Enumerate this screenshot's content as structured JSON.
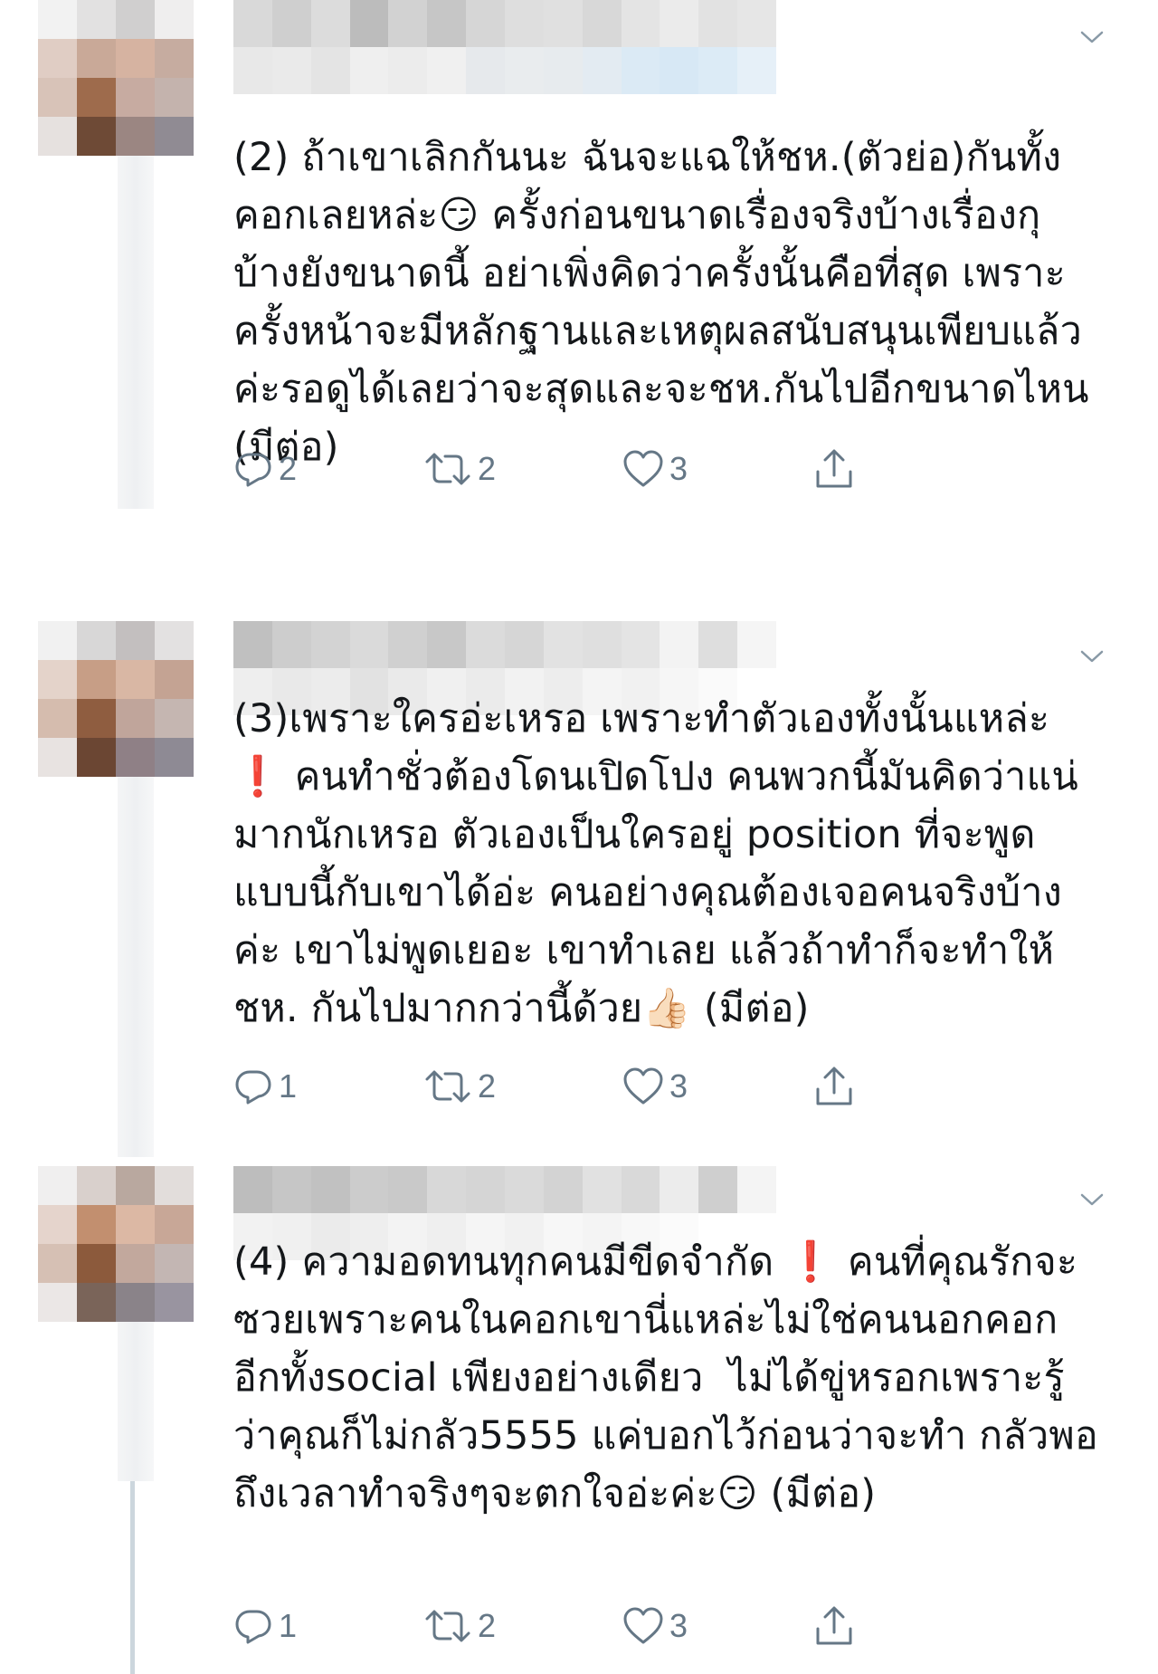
{
  "tweets": [
    {
      "text": "(2) ถ้าเขาเลิกกันนะ ฉันจะแฉให้ชห.(ตัวย่อ)กันทั้งคอกเลยหล่ะ😏 ครั้งก่อนขนาดเรื่องจริงบ้างเรื่องกุบ้างยังขนาดนี้ อย่าเพิ่งคิดว่าครั้งนั้นคือที่สุด เพราะครั้งหน้าจะมีหลักฐานและเหตุผลสนับสนุนเพียบแล้วค่ะรอดูได้เลยว่าจะสุดและจะชห.กันไปอีกขนาดไหน (มีต่อ)",
      "replies": "2",
      "retweets": "2",
      "likes": "3"
    },
    {
      "text": "(3)เพราะใครอ่ะเหรอ เพราะทำตัวเองทั้งนั้นแหล่ะ ❗️ คนทำชั่วต้องโดนเปิดโปง คนพวกนี้มันคิดว่าแน่มากนักเหรอ ตัวเองเป็นใครอยู่ position ที่จะพูดแบบนี้กับเขาได้อ่ะ คนอย่างคุณต้องเจอคนจริงบ้างค่ะ เขาไม่พูดเยอะ เขาทำเลย แล้วถ้าทำก็จะทำให้ชห. กันไปมากกว่านี้ด้วย👍🏻 (มีต่อ)",
      "replies": "1",
      "retweets": "2",
      "likes": "3"
    },
    {
      "text": "(4) ความอดทนทุกคนมีขีดจำกัด ❗️ คนที่คุณรักจะซวยเพราะคนในคอกเขานี่แหล่ะไม่ใช่คนนอกคอกอีกทั้งsocial เพียงอย่างเดียว  ไม่ได้ขู่หรอกเพราะรู้ว่าคุณก็ไม่กลัว5555 แค่บอกไว้ก่อนว่าจะทำ กลัวพอถึงเวลาทำจริงๆจะตกใจอ่ะค่ะ😏 (มีต่อ)",
      "replies": "1",
      "retweets": "2",
      "likes": "3"
    }
  ],
  "icons": {
    "reply": "reply-icon",
    "retweet": "retweet-icon",
    "like": "heart-icon",
    "share": "share-icon",
    "menu": "chevron-down-icon"
  },
  "colors": {
    "action_gray": "#657786",
    "text": "#14171a",
    "thread_line": "#ccd6dd"
  }
}
